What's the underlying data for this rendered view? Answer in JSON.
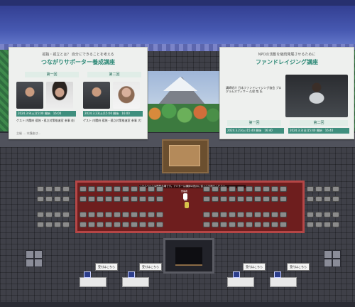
{
  "left_panel": {
    "subtitle": "孤独・孤立とは？ 自分にできることを考える",
    "title": "つながりサポーター養成講座",
    "session1": "第一回",
    "session2": "第二回",
    "date1": "2024.3.9(土)15:00 開始　16:00",
    "date2": "2024.3.23(土)15:00 開始　16:00",
    "speakers1": "ゲスト 内閣府 孤独・孤立対策推進室 参事 佐藤 直 氏",
    "speakers2": "ゲスト 内閣府 孤独・孤立対策推進室 参事 大野 進 氏",
    "footer": "主催 … 本講座は…"
  },
  "right_panel": {
    "subtitle": "NPOの活動を継続発展させるために",
    "title": "ファンドレイジング講座",
    "speaker": "講師紹介 日本ファンドレイジング協会 プログラムオフィサー 久保 哉 氏",
    "session1": "第一回",
    "session2": "第二回",
    "date1": "2024.3.23(土)15:40 開始　16:40",
    "date2": "2024.3.3(日)15:40 開始　16:40"
  },
  "announcement": "このスペースは講座会場です。アバターは講師の指示に従ってお座りください。",
  "stage_labels": {
    "a": "登壇者",
    "b": "MC"
  },
  "reception_signs": [
    "受付はこちら",
    "受付はこちら",
    "受付はこちら",
    "受付はこちら"
  ]
}
